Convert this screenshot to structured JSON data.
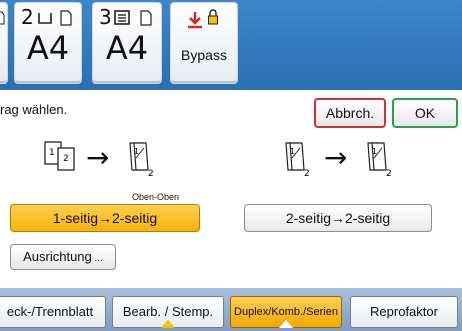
{
  "trays": [
    {
      "number": "2",
      "size": "A4"
    },
    {
      "number": "3",
      "size": "A4"
    }
  ],
  "bypass": {
    "label": "Bypass"
  },
  "instruction": "rag wählen.",
  "buttons": {
    "cancel": "Abbrch.",
    "ok": "OK"
  },
  "orientation_caption": "Oben-Oben",
  "options": {
    "one_to_two": "1-seitig→2-seitig",
    "two_to_two": "2-seitig→2-seitig",
    "orientation": "Ausrichtung"
  },
  "diagram_labels": {
    "page_one": "1",
    "page_two": "2"
  },
  "tabs": [
    {
      "label": "eck-/Trennblatt",
      "active": false
    },
    {
      "label": "Bearb. / Stemp.",
      "active": false
    },
    {
      "label": "Duplex/Komb./Serien",
      "active": true
    },
    {
      "label": "Reprofaktor",
      "active": false
    }
  ],
  "colors": {
    "header_blue": "#3d86c9",
    "active_yellow": "#f7b20a",
    "cancel_red": "#c9343b",
    "ok_green": "#2aa04a",
    "bypass_red": "#d1281f"
  },
  "icons": [
    "tray-icon",
    "bypass-arrow-icon",
    "lock-icon",
    "right-arrow-icon",
    "duplex-page-icon"
  ]
}
